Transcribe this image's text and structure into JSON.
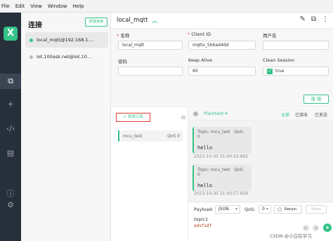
{
  "menubar": {
    "items": [
      "File",
      "Edit",
      "View",
      "Window",
      "Help"
    ]
  },
  "rail": {
    "logo": "X"
  },
  "connections": {
    "title": "连接",
    "new_button": "新建连接",
    "items": [
      {
        "label": "local_mqtt@192.168.1....",
        "status_color": "#34c388"
      },
      {
        "label": "iot.100ask.net@iot.10...",
        "status_color": "#bbbbbb"
      }
    ]
  },
  "header": {
    "name": "local_mqtt",
    "chevron": "︽"
  },
  "form": {
    "name_label": "名称",
    "name_value": "local_mqtt",
    "clientid_label": "Client ID",
    "clientid_value": "mqttx_5b6ad4dd",
    "username_label": "用户名",
    "password_label": "密码",
    "keepalive_label": "Keep Alive",
    "keepalive_value": "60",
    "cleansession_label": "Clean Session",
    "cleansession_value": "true",
    "connect_button": "连 接"
  },
  "subscriptions": {
    "add_button": "+ 添加订阅",
    "items": [
      {
        "topic": "mcu_test",
        "qos": "QoS 0"
      }
    ]
  },
  "messages": {
    "payload_type": "Plaintext",
    "filters": [
      "全部",
      "已接收",
      "已发送"
    ],
    "items": [
      {
        "topic": "Topic: mcu_test",
        "qos": "QoS: 0",
        "payload": "hello",
        "time": "2023-10-30 21:00:52:862"
      },
      {
        "topic": "Topic: mcu_test",
        "qos": "QoS: 0",
        "payload": "hello",
        "time": "2023-10-30 21:00:57:854"
      }
    ]
  },
  "composer": {
    "payload_label": "Payload:",
    "format": "JSON",
    "qos_label": "QoS:",
    "qos_value": "0",
    "retain_label": "Retain",
    "meta_label": "Meta",
    "topic_value": "topic1",
    "payload_value": "adsfsdf"
  },
  "watermark": "CSDN @小白在学习"
}
